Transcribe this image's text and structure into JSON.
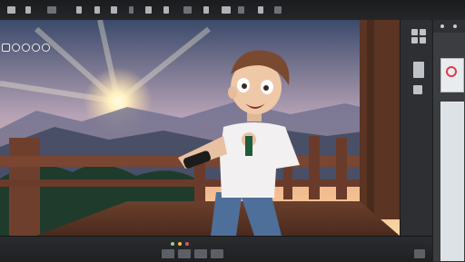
{
  "app": {
    "accent_color": "#e9eef4",
    "background_color": "#2a2c2f"
  },
  "toolbar": {
    "tools": [
      {
        "icon": "tool-1-icon"
      },
      {
        "icon": "tool-2-icon"
      },
      {
        "icon": "tool-3-icon"
      },
      {
        "icon": "tool-4-icon"
      },
      {
        "icon": "tool-5-icon"
      },
      {
        "icon": "tool-6-icon"
      },
      {
        "icon": "tool-7-icon"
      },
      {
        "icon": "tool-8-icon"
      },
      {
        "icon": "tool-9-icon"
      },
      {
        "icon": "tool-10-icon"
      },
      {
        "icon": "tool-11-icon"
      },
      {
        "icon": "tool-12-icon"
      },
      {
        "icon": "tool-13-icon"
      },
      {
        "icon": "tool-14-icon"
      },
      {
        "icon": "tool-15-icon"
      }
    ]
  },
  "viewport": {
    "zoom_controls": [
      "zoom-1-icon",
      "zoom-2-icon",
      "zoom-3-icon",
      "zoom-4-icon",
      "zoom-5-icon"
    ],
    "scene": {
      "sky_colors": [
        "#3b4a6b",
        "#b7a3b6",
        "#f2b58a",
        "#fff3cf"
      ],
      "sun_color": "#fffbe8",
      "character": "boy-on-balcony-at-sunset"
    }
  },
  "side_panel": {
    "layout_buttons": [
      "grid-layout-icon",
      "split-layout-icon",
      "single-layout-icon"
    ]
  },
  "timeline": {
    "controls": [
      "play-icon",
      "frame-icon",
      "marker-icon",
      "range-icon",
      "export-icon"
    ]
  }
}
